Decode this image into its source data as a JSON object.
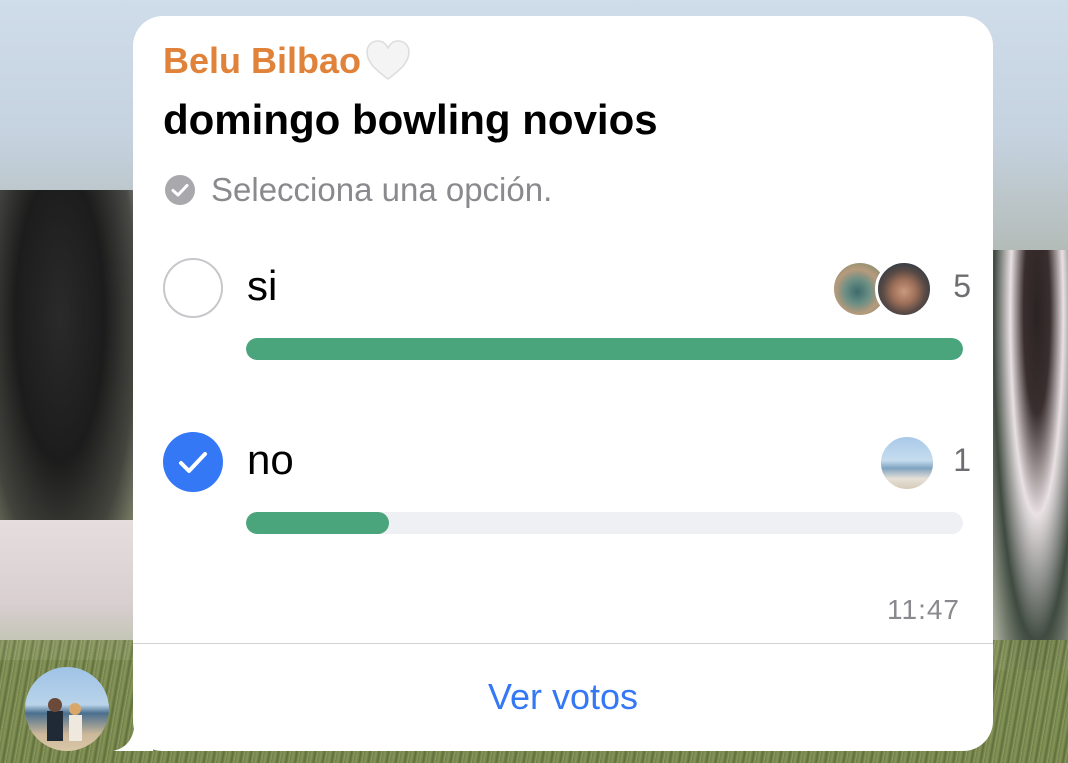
{
  "message": {
    "sender_name": "Belu Bilbao",
    "sender_color": "#e0823a",
    "heart_icon": "white-heart-icon"
  },
  "poll": {
    "question": "domingo bowling novios",
    "hint": "Selecciona una opción.",
    "hint_icon": "check-circle-icon",
    "options": [
      {
        "label": "si",
        "votes": "5",
        "fill_fraction": 1.0,
        "selected": false,
        "voter_avatars": 2
      },
      {
        "label": "no",
        "votes": "1",
        "fill_fraction": 0.2,
        "selected": true,
        "voter_avatars": 1
      }
    ],
    "bar_color": "#4aa57d",
    "check_color": "#3478f6"
  },
  "timestamp": "11:47",
  "footer": {
    "view_votes_label": "Ver votos",
    "link_color": "#3478f6"
  }
}
